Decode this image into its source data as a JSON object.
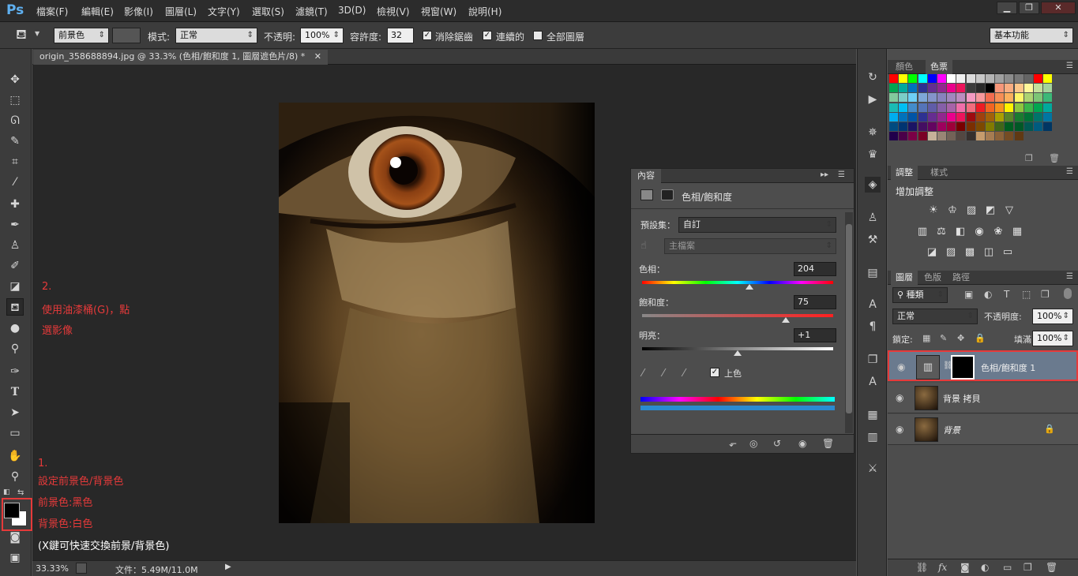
{
  "app": {
    "logo": "Ps"
  },
  "menu": [
    {
      "label": "檔案(F)"
    },
    {
      "label": "編輯(E)"
    },
    {
      "label": "影像(I)"
    },
    {
      "label": "圖層(L)"
    },
    {
      "label": "文字(Y)"
    },
    {
      "label": "選取(S)"
    },
    {
      "label": "濾鏡(T)"
    },
    {
      "label": "3D(D)"
    },
    {
      "label": "檢視(V)"
    },
    {
      "label": "視窗(W)"
    },
    {
      "label": "說明(H)"
    }
  ],
  "window_controls": {
    "minimize": "▁",
    "restore": "❐",
    "close": "✕"
  },
  "options": {
    "fill_source": "前景色",
    "mode_label": "模式:",
    "mode_value": "正常",
    "opacity_label": "不透明:",
    "opacity_value": "100%",
    "tolerance_label": "容許度:",
    "tolerance_value": "32",
    "antialias_label": "消除鋸齒",
    "antialias_checked": "✓",
    "contiguous_label": "連續的",
    "contiguous_checked": "✓",
    "all_layers_label": "全部圖層",
    "workspace": "基本功能"
  },
  "document": {
    "tab_title": "origin_358688894.jpg @ 33.3% (色相/飽和度 1, 圖層遮色片/8) *",
    "close": "✕"
  },
  "annotations": {
    "step2_num": "2.",
    "step2_line1": "使用油漆桶(G)，點",
    "step2_line2": "選影像",
    "step1_num": "1.",
    "step1_line1": "設定前景色/背景色",
    "step1_line2": "前景色:黑色",
    "step1_line3": "背景色:白色",
    "step1_tip": "(X鍵可快速交換前景/背景色)"
  },
  "status": {
    "zoom": "33.33%",
    "file_info": "文件：5.49M/11.0M"
  },
  "properties": {
    "tab": "內容",
    "title": "色相/飽和度",
    "preset_label": "預設集：",
    "preset_value": "自訂",
    "channel_value": "主檔案",
    "hue_label": "色相：",
    "hue_value": "204",
    "hue_pos": 0.56,
    "sat_label": "飽和度：",
    "sat_value": "75",
    "sat_pos": 0.75,
    "light_label": "明亮：",
    "light_value": "+1",
    "light_pos": 0.5,
    "colorize_label": "上色",
    "colorize_checked": "✓"
  },
  "swatches_panel": {
    "tab_color": "顏色",
    "tab_swatches": "色票"
  },
  "adjustments_panel": {
    "tab_adjust": "調整",
    "tab_styles": "樣式",
    "add_label": "增加調整"
  },
  "layers_panel": {
    "tab_layers": "圖層",
    "tab_channels": "色版",
    "tab_paths": "路徑",
    "filter_kind": "種類",
    "blend_mode": "正常",
    "opacity_label": "不透明度:",
    "opacity_value": "100%",
    "lock_label": "鎖定:",
    "fill_label": "填滿:",
    "fill_value": "100%",
    "layers": [
      {
        "name": "色相/飽和度 1"
      },
      {
        "name": "背景 拷貝"
      },
      {
        "name": "背景"
      }
    ]
  },
  "colors": {
    "accent_red": "#e63a3a",
    "selected_layer": "#6a7a8e"
  }
}
